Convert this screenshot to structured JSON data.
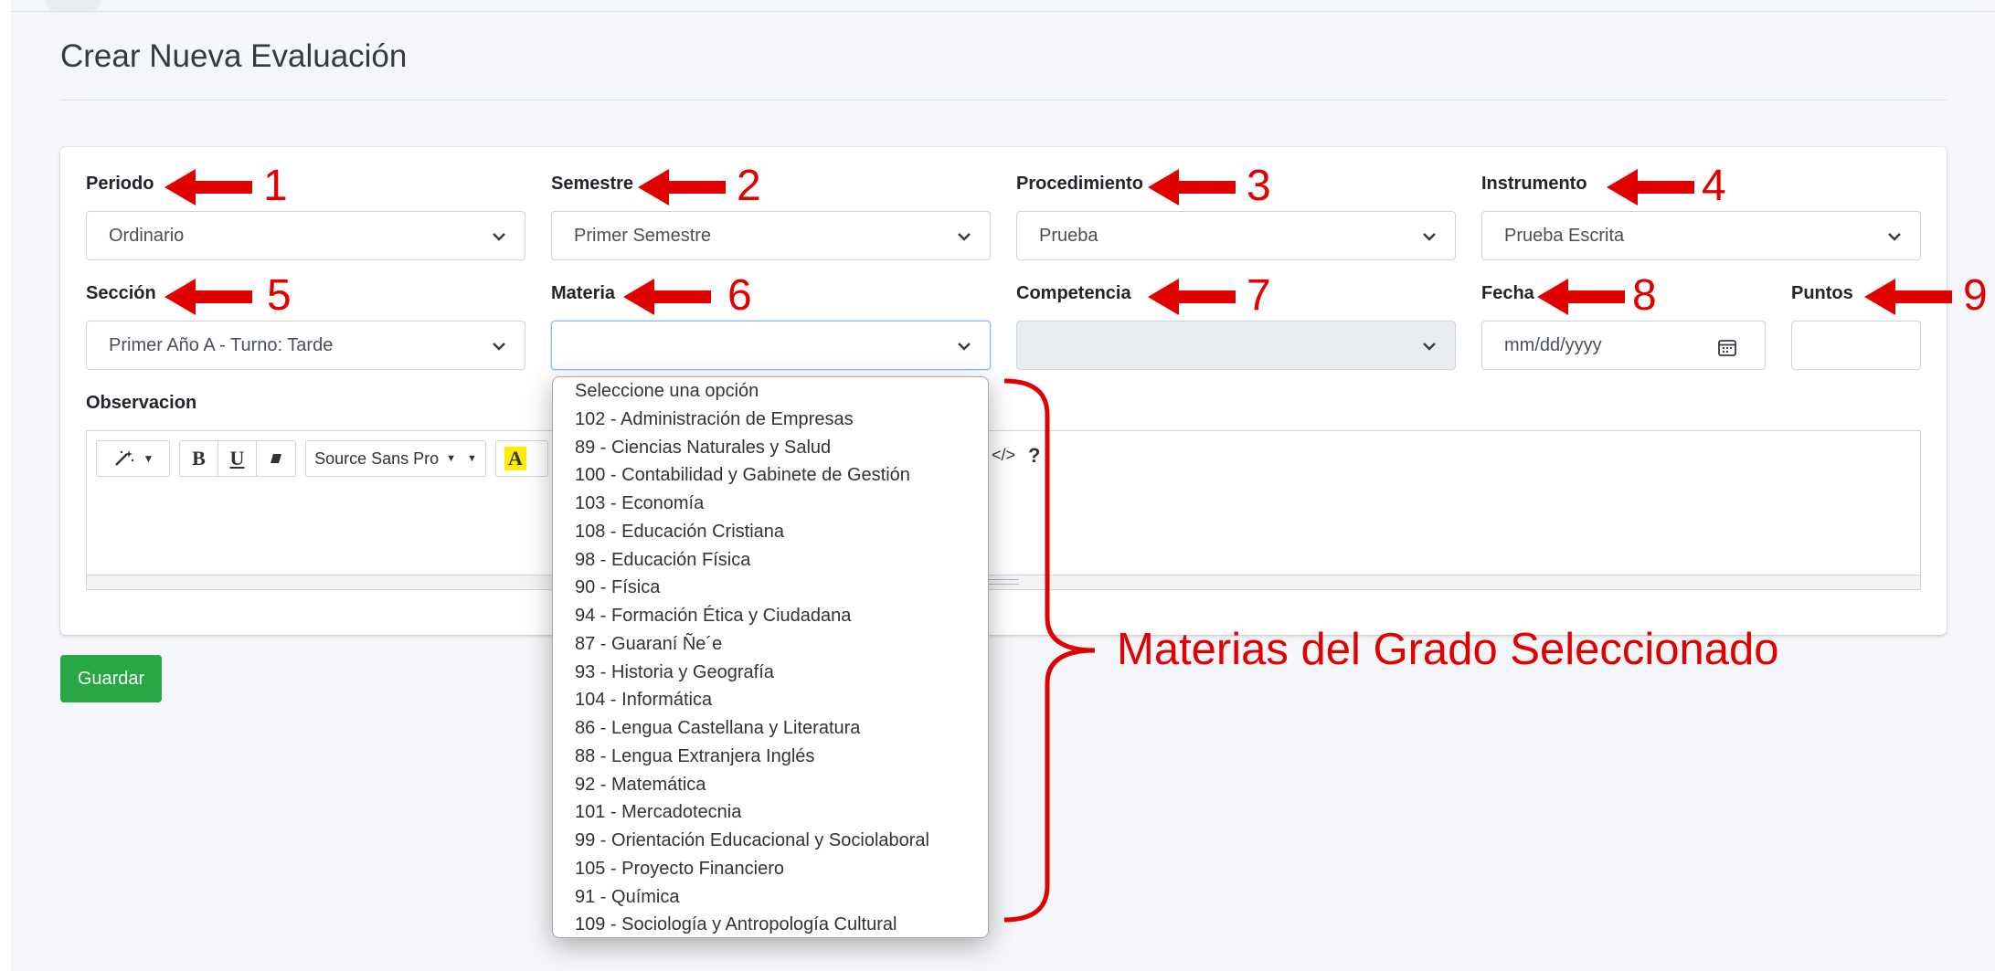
{
  "page": {
    "title": "Crear Nueva Evaluación"
  },
  "form": {
    "periodo": {
      "label": "Periodo",
      "value": "Ordinario"
    },
    "semestre": {
      "label": "Semestre",
      "value": "Primer Semestre"
    },
    "procedimiento": {
      "label": "Procedimiento",
      "value": "Prueba"
    },
    "instrumento": {
      "label": "Instrumento",
      "value": "Prueba Escrita"
    },
    "seccion": {
      "label": "Sección",
      "value": "Primer Año A - Turno: Tarde"
    },
    "materia": {
      "label": "Materia",
      "value": ""
    },
    "competencia": {
      "label": "Competencia",
      "value": ""
    },
    "fecha": {
      "label": "Fecha",
      "placeholder": "mm/dd/yyyy"
    },
    "puntos": {
      "label": "Puntos",
      "value": ""
    },
    "observacion": {
      "label": "Observacion"
    }
  },
  "editor_toolbar": {
    "style_icon": "magic-wand-icon",
    "bold": "B",
    "underline": "U",
    "eraser_icon": "eraser-icon",
    "font_name": "Source Sans Pro",
    "font_color_label": "A",
    "code_view": "</>",
    "help": "?"
  },
  "buttons": {
    "save": "Guardar"
  },
  "materia_dropdown": {
    "options": [
      "Seleccione una opción",
      "102 - Administración de Empresas",
      "89 - Ciencias Naturales y Salud",
      "100 - Contabilidad y Gabinete de Gestión",
      "103 - Economía",
      "108 - Educación Cristiana",
      "98 - Educación Física",
      "90 - Física",
      "94 - Formación Ética y Ciudadana",
      "87 - Guaraní Ñe´e",
      "93 - Historia y Geografía",
      "104 - Informática",
      "86 - Lengua Castellana y Literatura",
      "88 - Lengua Extranjera Inglés",
      "92 - Matemática",
      "101 - Mercadotecnia",
      "99 - Orientación Educacional y Sociolaboral",
      "105 - Proyecto Financiero",
      "91 - Química",
      "109 - Sociología y Antropología Cultural"
    ]
  },
  "annotations": {
    "numbers": [
      "1",
      "2",
      "3",
      "4",
      "5",
      "6",
      "7",
      "8",
      "9"
    ],
    "brace_text": "Materias del Grado Seleccionado"
  },
  "colors": {
    "annotation": "#e00000",
    "save_button": "#28a745"
  }
}
